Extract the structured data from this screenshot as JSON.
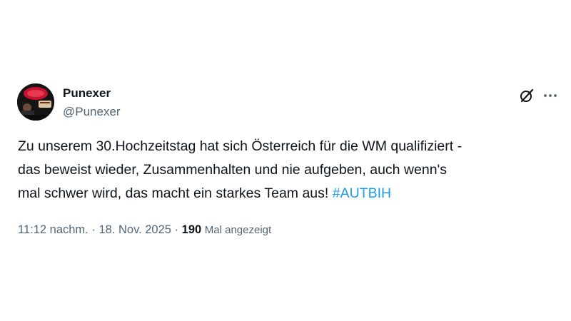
{
  "tweet": {
    "display_name": "Punexer",
    "handle": "@Punexer",
    "text_lines": [
      "Zu unserem 30.Hochzeitstag hat sich Österreich für die WM qualifiziert -",
      "das beweist wieder, Zusammenhalten und nie aufgeben, auch wenn's",
      "mal schwer wird, das macht ein starkes Team aus! "
    ],
    "hashtag": "#AUTBIH",
    "time": "11:12 nachm.",
    "separator": "·",
    "date": "18. Nov. 2025",
    "views_count": "190",
    "views_label": "Mal angezeigt"
  },
  "icons": {
    "avatar": "profile-photo",
    "grok": "grok-slash-circle-icon",
    "more": "more-horizontal-icon"
  },
  "colors": {
    "text": "#0f1419",
    "secondary": "#536471",
    "link": "#1d9bf0"
  }
}
